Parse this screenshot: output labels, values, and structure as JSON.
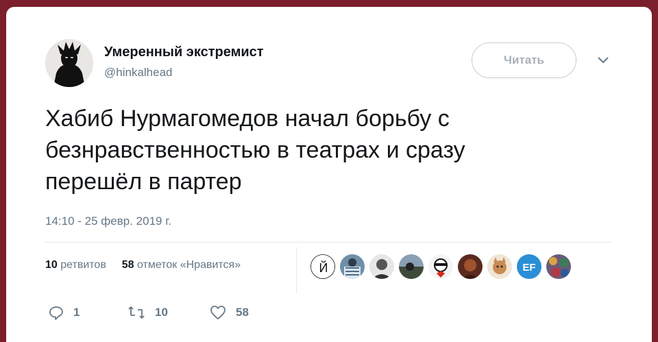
{
  "author": {
    "name": "Умеренный экстремист",
    "handle": "@hinkalhead"
  },
  "follow_button": {
    "label": "Читать"
  },
  "tweet": {
    "lines": [
      "Хабиб Нурмагомедов начал борьбу с",
      "безнравственностью в театрах и сразу",
      "перешёл в партер"
    ],
    "timestamp": "14:10 - 25 февр. 2019 г."
  },
  "stats": {
    "retweets_count": "10",
    "retweets_label": "ретвитов",
    "likes_count": "58",
    "likes_label": "отметок «Нравится»"
  },
  "likers": [
    {
      "icon": "avatar-letter",
      "text": "Й",
      "bg": "#ffffff"
    },
    {
      "icon": "avatar",
      "bg": "#6f8fa8"
    },
    {
      "icon": "avatar",
      "bg": "#8a8a8a"
    },
    {
      "icon": "avatar",
      "bg": "#3f4a3a"
    },
    {
      "icon": "avatar",
      "bg": "#d9d9d9"
    },
    {
      "icon": "avatar",
      "bg": "#5a2a1e"
    },
    {
      "icon": "avatar",
      "bg": "#c98b54"
    },
    {
      "icon": "avatar-letter",
      "text": "EF",
      "bg": "#2b8fd6"
    },
    {
      "icon": "avatar",
      "bg": "#6a5a7a"
    }
  ],
  "actions": {
    "reply_count": "1",
    "retweet_count": "10",
    "like_count": "58"
  },
  "colors": {
    "background": "#7a1f2b",
    "text_primary": "#14171a",
    "text_secondary": "#657786",
    "divider": "#e1e8ed"
  }
}
